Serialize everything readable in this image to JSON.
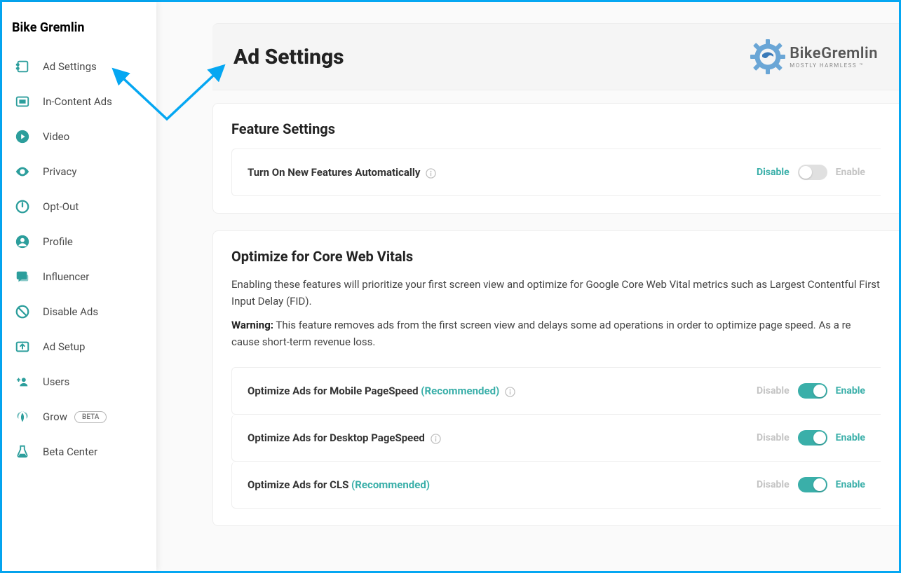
{
  "brand": "Bike Gremlin",
  "sidebar": {
    "items": [
      {
        "label": "Ad Settings",
        "icon": "settings-panel-icon"
      },
      {
        "label": "In-Content Ads",
        "icon": "inline-ad-icon"
      },
      {
        "label": "Video",
        "icon": "play-circle-icon"
      },
      {
        "label": "Privacy",
        "icon": "eye-icon"
      },
      {
        "label": "Opt-Out",
        "icon": "power-icon"
      },
      {
        "label": "Profile",
        "icon": "person-circle-icon"
      },
      {
        "label": "Influencer",
        "icon": "chat-icon"
      },
      {
        "label": "Disable Ads",
        "icon": "no-entry-icon"
      },
      {
        "label": "Ad Setup",
        "icon": "upload-box-icon"
      },
      {
        "label": "Users",
        "icon": "users-plus-icon"
      },
      {
        "label": "Grow",
        "icon": "leaf-icon",
        "badge": "BETA"
      },
      {
        "label": "Beta Center",
        "icon": "beaker-icon"
      }
    ]
  },
  "header": {
    "title": "Ad Settings",
    "logo_main": "BikeGremlin",
    "logo_sub": "MOSTLY HARMLESS ™"
  },
  "feature": {
    "title": "Feature Settings",
    "row_label": "Turn On New Features Automatically",
    "disable": "Disable",
    "enable": "Enable",
    "on": false
  },
  "cwv": {
    "title": "Optimize for Core Web Vitals",
    "desc": "Enabling these features will prioritize your first screen view and optimize for Google Core Web Vital metrics such as Largest Contentful First Input Delay (FID).",
    "warning_label": "Warning:",
    "warning_text": " This feature removes ads from the first screen view and delays some ad operations in order to optimize page speed. As a re cause short-term revenue loss.",
    "disable": "Disable",
    "enable": "Enable",
    "rows": [
      {
        "label": "Optimize Ads for Mobile PageSpeed",
        "recommended": "(Recommended)",
        "info": true,
        "on": true
      },
      {
        "label": "Optimize Ads for Desktop PageSpeed",
        "recommended": "",
        "info": true,
        "on": true
      },
      {
        "label": "Optimize Ads for CLS",
        "recommended": "(Recommended)",
        "info": false,
        "on": true
      }
    ]
  }
}
